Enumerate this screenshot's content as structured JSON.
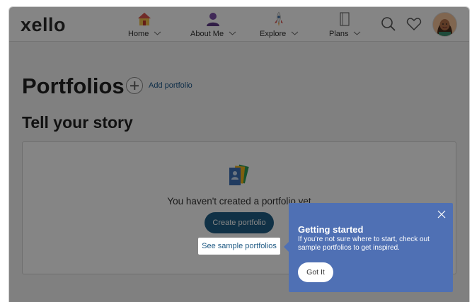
{
  "header": {
    "logo": "xello",
    "nav": [
      {
        "label": "Home",
        "icon": "house-icon"
      },
      {
        "label": "About Me",
        "icon": "person-icon"
      },
      {
        "label": "Explore",
        "icon": "rocket-icon"
      },
      {
        "label": "Plans",
        "icon": "notebook-icon"
      }
    ],
    "search_icon": "search-icon",
    "favorites_icon": "heart-icon",
    "avatar_icon": "avatar"
  },
  "main": {
    "title": "Portfolios",
    "add_label": "Add portfolio",
    "section_title": "Tell your story",
    "empty_message": "You haven't created a portfolio yet",
    "create_label": "Create portfolio",
    "sample_label": "See sample portfolios"
  },
  "popover": {
    "title": "Getting started",
    "body": "If you're not sure where to start, check out sample portfolios to get inspired.",
    "button": "Got It"
  },
  "colors": {
    "primary_button": "#1f5f86",
    "popover_bg": "#4f70b4",
    "overlay": "rgba(0,0,0,0.48)"
  }
}
